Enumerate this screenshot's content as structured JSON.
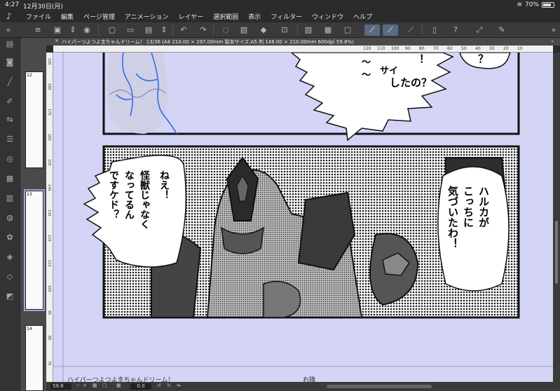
{
  "status": {
    "time": "4:27",
    "date": "12月30日(月)",
    "battery": "70%"
  },
  "menu": [
    "ファイル",
    "編集",
    "ページ管理",
    "アニメーション",
    "レイヤー",
    "選択範囲",
    "表示",
    "フィルター",
    "ウィンドウ",
    "ヘルプ"
  ],
  "document": {
    "tab_title": "ハイパーつよつよ圭ちゃんドリーム！ 13/36 (A4 210.00 × 297.00mm 製本サイズ:A5 判 148.00 × 210.00mm 600dpi 59.8%)"
  },
  "ruler_h": [
    "120",
    "110",
    "100",
    "90",
    "80",
    "70",
    "60",
    "50",
    "40",
    "30",
    "20",
    "10"
  ],
  "ruler_v": [
    "190",
    "180",
    "170",
    "160",
    "150",
    "140",
    "130",
    "120",
    "110",
    "100",
    "90",
    "80",
    "70"
  ],
  "thumbnails": [
    "12",
    "13",
    "14"
  ],
  "manga": {
    "top_bubble": [
      "！",
      "したの？",
      "サイ",
      "～",
      "～"
    ],
    "top_right_mark": "？",
    "left_bubble": [
      "ねえ！",
      "怪獣じゃなく",
      "なってるん",
      "ですケド？"
    ],
    "right_bubble": [
      "ハルカが",
      "こっちに",
      "気づいたわ！"
    ],
    "footer_left": "ハイパーつよつよ圭ちゃんドリーム！",
    "footer_right": "右隣"
  },
  "bottom": {
    "zoom": "59.8",
    "rotation": "0.0"
  },
  "colors": {
    "canvas": "#d4d4f7",
    "accent": "#5a6a85",
    "panel_border": "#111111",
    "sketch_blue": "#2f6ee8"
  }
}
